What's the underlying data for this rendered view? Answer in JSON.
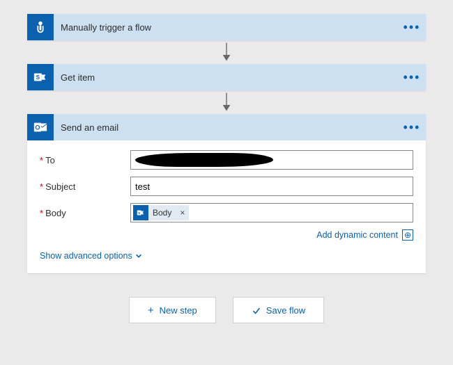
{
  "steps": {
    "trigger": {
      "title": "Manually trigger a flow"
    },
    "getitem": {
      "title": "Get item"
    },
    "email": {
      "title": "Send an email"
    }
  },
  "email_form": {
    "to_label": "To",
    "to_value": "",
    "subject_label": "Subject",
    "subject_value": "test",
    "body_label": "Body",
    "body_token": "Body",
    "dynamic_label": "Add dynamic content",
    "advanced_label": "Show advanced options"
  },
  "buttons": {
    "new_step": "New step",
    "save_flow": "Save flow"
  }
}
